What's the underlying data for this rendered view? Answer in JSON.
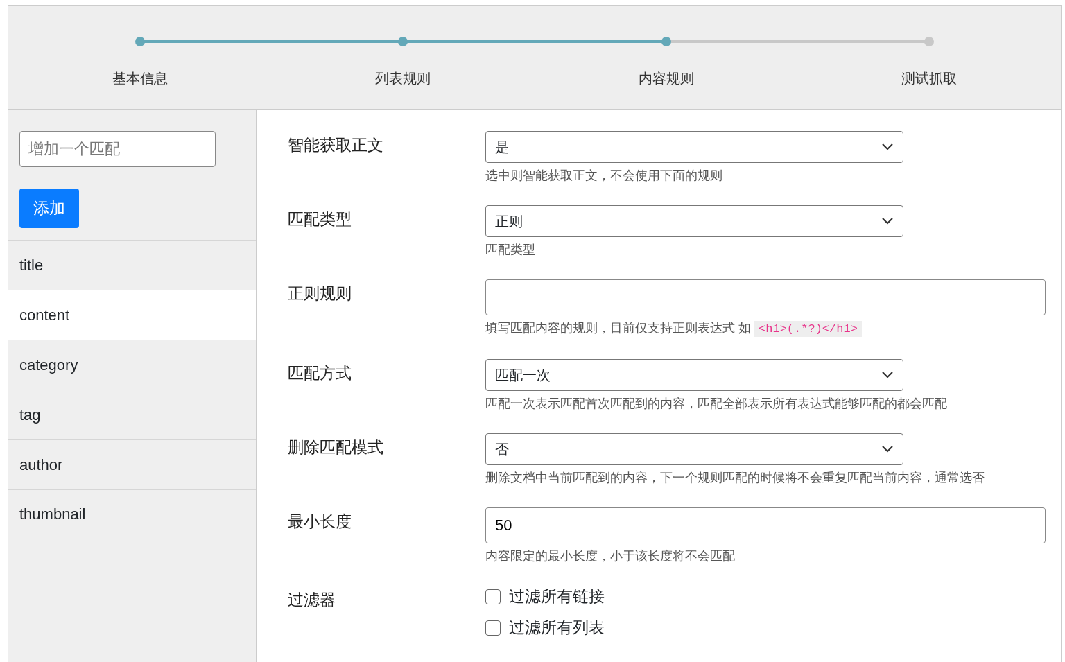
{
  "steps": [
    {
      "label": "基本信息",
      "completed": true
    },
    {
      "label": "列表规则",
      "completed": true
    },
    {
      "label": "内容规则",
      "completed": true
    },
    {
      "label": "测试抓取",
      "completed": false
    }
  ],
  "sidebar": {
    "input_placeholder": "增加一个匹配",
    "add_button": "添加",
    "items": [
      {
        "label": "title",
        "selected": false
      },
      {
        "label": "content",
        "selected": true
      },
      {
        "label": "category",
        "selected": false
      },
      {
        "label": "tag",
        "selected": false
      },
      {
        "label": "author",
        "selected": false
      },
      {
        "label": "thumbnail",
        "selected": false
      }
    ]
  },
  "form": [
    {
      "kind": "select",
      "label": "智能获取正文",
      "value": "是",
      "hint": "选中则智能获取正文，不会使用下面的规则"
    },
    {
      "kind": "select",
      "label": "匹配类型",
      "value": "正则",
      "hint": "匹配类型"
    },
    {
      "kind": "text",
      "label": "正则规则",
      "hint": "填写匹配内容的规则，目前仅支持正则表达式 如",
      "hint_code": "<h1>(.*?)</h1>"
    },
    {
      "kind": "select",
      "label": "匹配方式",
      "value": "匹配一次",
      "hint": "匹配一次表示匹配首次匹配到的内容，匹配全部表示所有表达式能够匹配的都会匹配"
    },
    {
      "kind": "select",
      "label": "删除匹配模式",
      "value": "否",
      "hint": "删除文档中当前匹配到的内容，下一个规则匹配的时候将不会重复匹配当前内容，通常选否"
    },
    {
      "kind": "text",
      "label": "最小长度",
      "value": "50",
      "hint": "内容限定的最小长度，小于该长度将不会匹配"
    },
    {
      "kind": "checkboxes",
      "label": "过滤器",
      "options": [
        {
          "label": "过滤所有链接",
          "checked": false
        },
        {
          "label": "过滤所有列表",
          "checked": false
        }
      ]
    }
  ]
}
